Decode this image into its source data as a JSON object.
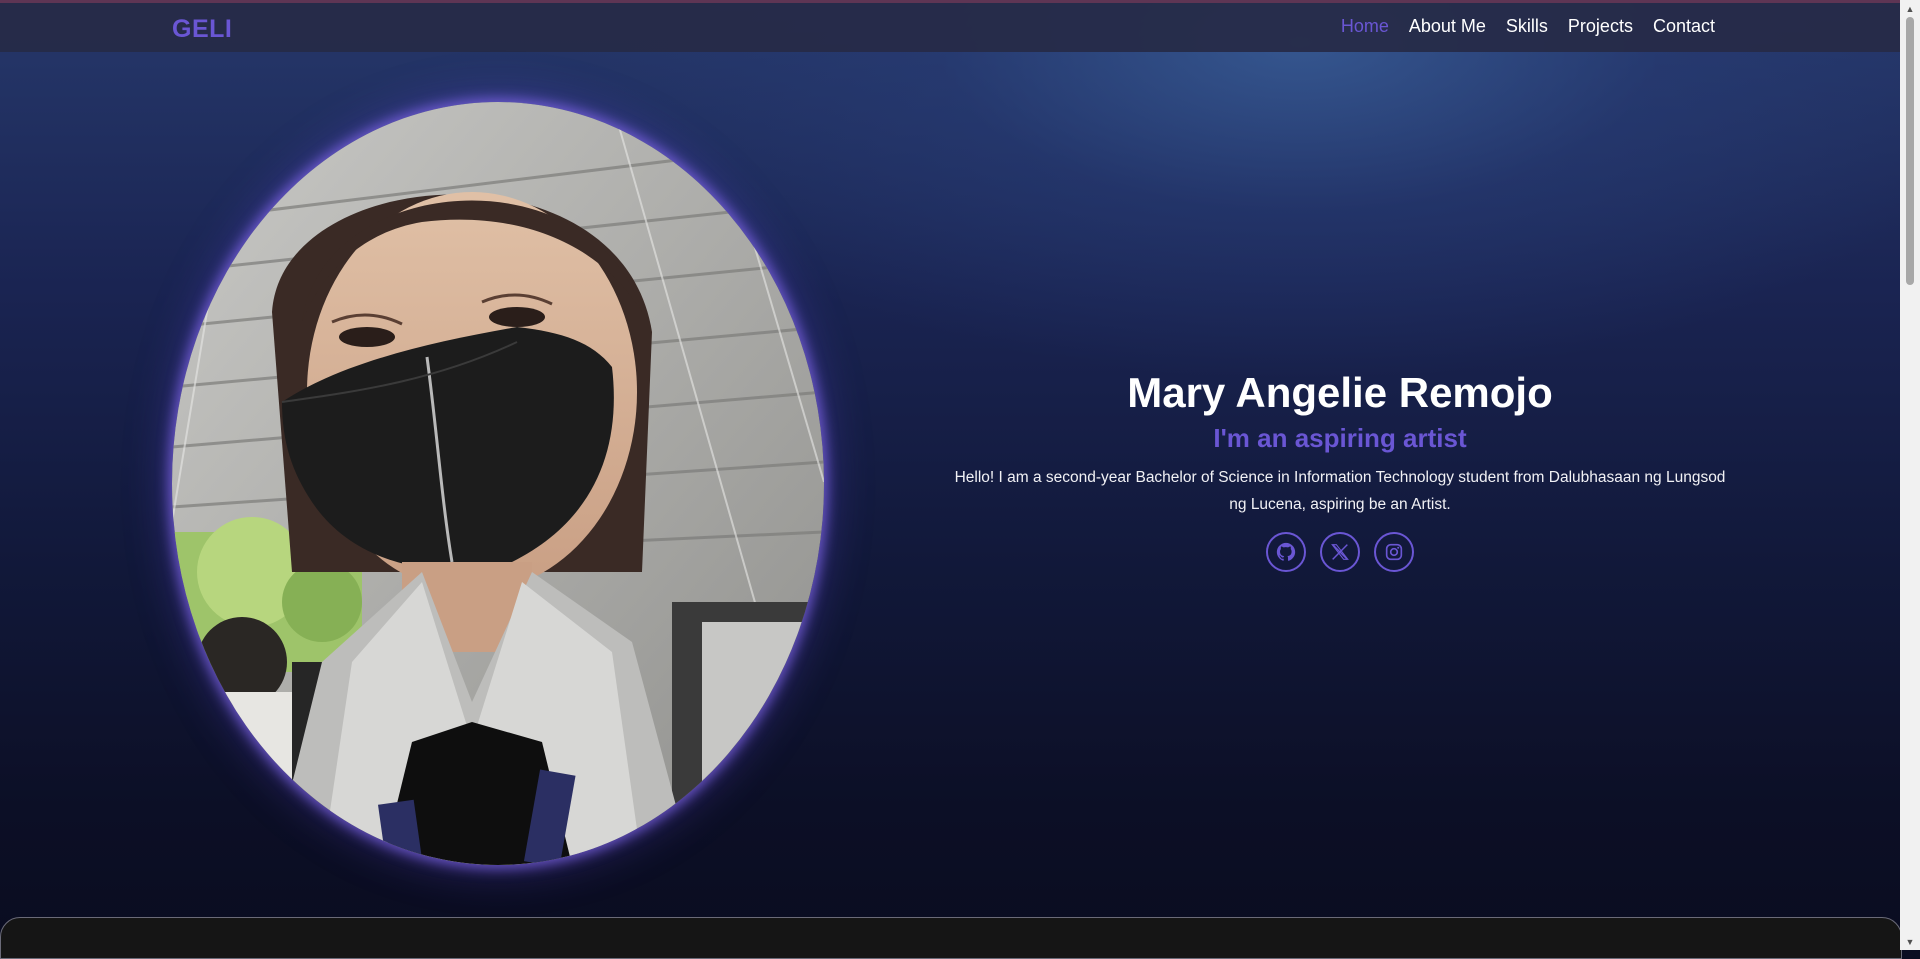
{
  "nav": {
    "brand": "GELI",
    "links": [
      {
        "label": "Home",
        "active": true
      },
      {
        "label": "About Me",
        "active": false
      },
      {
        "label": "Skills",
        "active": false
      },
      {
        "label": "Projects",
        "active": false
      },
      {
        "label": "Contact",
        "active": false
      }
    ]
  },
  "hero": {
    "name": "Mary Angelie Remojo",
    "tagline": "I'm an aspiring artist",
    "bio": "Hello! I am a second-year Bachelor of Science in Information Technology student from Dalubhasaan ng Lungsod ng Lucena, aspiring be an Artist.",
    "socials": [
      {
        "icon": "github-icon"
      },
      {
        "icon": "x-icon"
      },
      {
        "icon": "instagram-icon"
      }
    ]
  },
  "colors": {
    "accent": "#6a56d4",
    "text": "#ffffff",
    "navbar": "#262a46",
    "background_top": "#26386b",
    "background_bottom": "#0a0c20"
  },
  "scrollbar": {
    "up_glyph": "▲",
    "down_glyph": "▼"
  }
}
